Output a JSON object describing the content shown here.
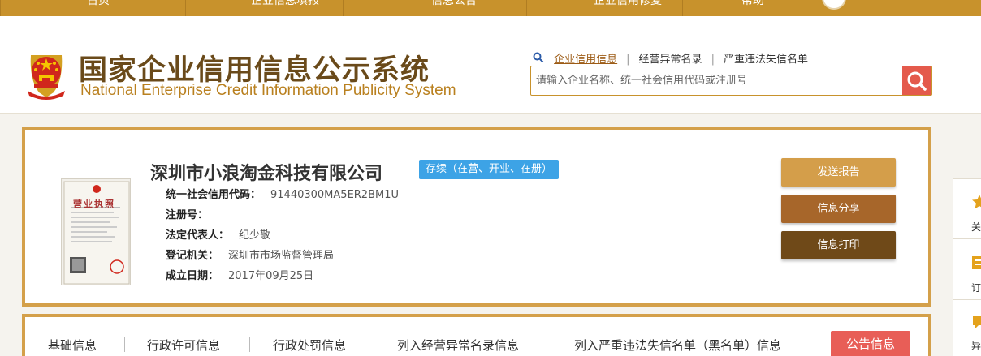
{
  "topnav": {
    "items": [
      "首页",
      "企业信息填报",
      "信息公告",
      "企业信用修复",
      "帮助"
    ]
  },
  "header": {
    "title_cn": "国家企业信用信息公示系统",
    "title_en": "National Enterprise Credit Information Publicity System",
    "search_links": [
      "企业信用信息",
      "经营异常名录",
      "严重违法失信名单"
    ],
    "search_placeholder": "请输入企业名称、统一社会信用代码或注册号"
  },
  "company": {
    "name": "深圳市小浪淘金科技有限公司",
    "status": "存续（在营、开业、在册）",
    "fields": [
      {
        "label": "统一社会信用代码：",
        "value": "91440300MA5ER2BM1U"
      },
      {
        "label": "注册号：",
        "value": ""
      },
      {
        "label": "法定代表人：",
        "value": "纪少敬"
      },
      {
        "label": "登记机关：",
        "value": "深圳市市场监督管理局"
      },
      {
        "label": "成立日期：",
        "value": "2017年09月25日"
      }
    ],
    "license_title": "营业执照",
    "buttons": {
      "report": "发送报告",
      "share": "信息分享",
      "print": "信息打印"
    }
  },
  "tabs": [
    "基础信息",
    "行政许可信息",
    "行政处罚信息",
    "列入经营异常名录信息",
    "列入严重违法失信名单（黑名单）信息",
    "公告信息"
  ],
  "float_panel": [
    "关",
    "订",
    "异"
  ],
  "colors": {
    "gold": "#c8922c",
    "brown": "#6a4a1a",
    "red": "#e45a4c",
    "blue": "#3da3e6"
  }
}
